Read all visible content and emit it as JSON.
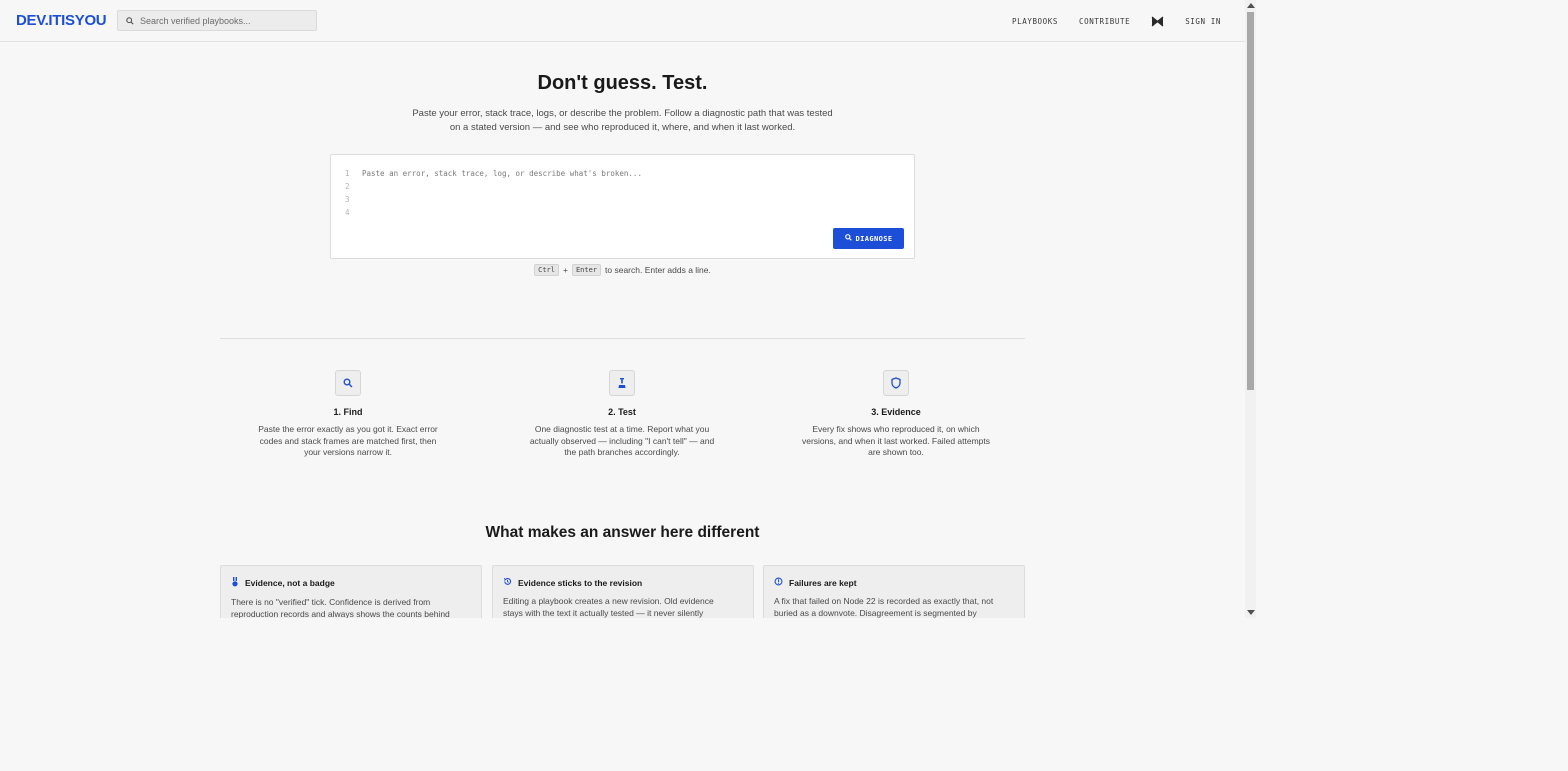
{
  "header": {
    "logo": "DEV.ITISYOU",
    "search_placeholder": "Search verified playbooks...",
    "nav": {
      "playbooks": "PLAYBOOKS",
      "contribute": "CONTRIBUTE",
      "sign_in": "SIGN IN"
    }
  },
  "hero": {
    "title": "Don't guess. Test.",
    "subtitle_line1": "Paste your error, stack trace, logs, or describe the problem. Follow a diagnostic path that was tested",
    "subtitle_line2": "on a stated version — and see who reproduced it, where, and when it last worked."
  },
  "editor": {
    "line_numbers": [
      "1",
      "2",
      "3",
      "4"
    ],
    "placeholder": "Paste an error, stack trace, log, or describe what's broken...",
    "diagnose_label": "DIAGNOSE"
  },
  "hint": {
    "key1": "Ctrl",
    "plus": "+",
    "key2": "Enter",
    "text": "to search. Enter adds a line."
  },
  "steps": [
    {
      "title": "1. Find",
      "desc": [
        "Paste the error exactly as you got it. Exact error",
        "codes and stack frames are matched first, then",
        "your versions narrow it."
      ]
    },
    {
      "title": "2. Test",
      "desc": [
        "One diagnostic test at a time. Report what you",
        "actually observed — including \"I can't tell\" — and",
        "the path branches accordingly."
      ]
    },
    {
      "title": "3. Evidence",
      "desc": [
        "Every fix shows who reproduced it, on which",
        "versions, and when it last worked. Failed attempts",
        "are shown too."
      ]
    }
  ],
  "section": {
    "title": "What makes an answer here different"
  },
  "cards": [
    {
      "title": "Evidence, not a badge",
      "body": [
        "There is no \"verified\" tick. Confidence is derived from",
        "reproduction records and always shows the counts behind"
      ]
    },
    {
      "title": "Evidence sticks to the revision",
      "body": [
        "Editing a playbook creates a new revision. Old evidence",
        "stays with the text it actually tested — it never silently"
      ]
    },
    {
      "title": "Failures are kept",
      "body": [
        "A fix that failed on Node 22 is recorded as exactly that, not",
        "buried as a downvote. Disagreement is segmented by"
      ]
    }
  ],
  "colors": {
    "accent": "#1d4ed8",
    "background": "#f7f7f7",
    "card": "#eeeeee"
  }
}
